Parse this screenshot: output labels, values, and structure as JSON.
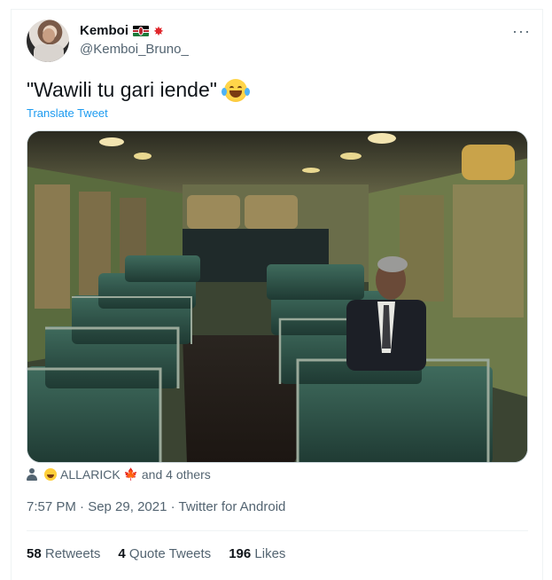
{
  "author": {
    "display_name": "Kemboi",
    "handle": "@Kemboi_Bruno_",
    "badges": [
      "kenya-flag-icon",
      "collision-icon"
    ]
  },
  "tweet": {
    "text": "\"Wawili tu gari iende\"",
    "emoji": "face-with-tears-of-joy-icon",
    "translate_label": "Translate Tweet",
    "more_label": "···"
  },
  "media": {
    "kind": "photo",
    "colors": {
      "seat": "#2f4f45",
      "wall": "#6e7a4a",
      "floor": "#3a2a20"
    }
  },
  "liked_by": {
    "name": "ALLARICK",
    "suffix": "and 4 others"
  },
  "meta": {
    "timestamp": "7:57 PM · Sep 29, 2021 · Twitter for Android"
  },
  "stats": {
    "retweets_count": "58",
    "retweets_label": "Retweets",
    "quotes_count": "4",
    "quotes_label": "Quote Tweets",
    "likes_count": "196",
    "likes_label": "Likes"
  },
  "colors": {
    "link": "#1d9bf0",
    "secondary_text": "#536471",
    "primary_text": "#0f1419"
  }
}
